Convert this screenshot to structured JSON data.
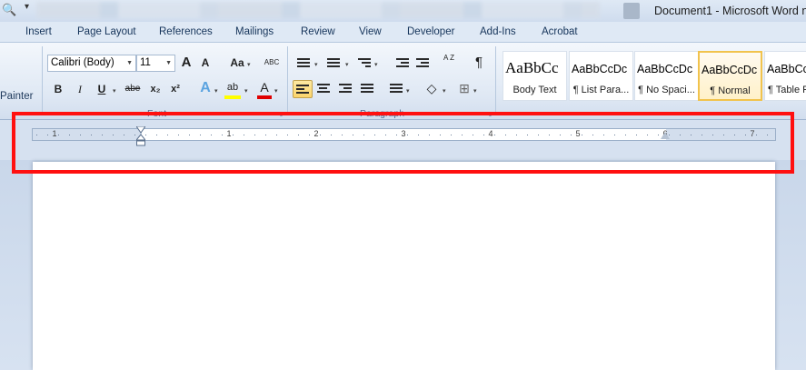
{
  "window": {
    "title": "Document1  -  Microsoft Word n"
  },
  "tabs": [
    "Insert",
    "Page Layout",
    "References",
    "Mailings",
    "Review",
    "View",
    "Developer",
    "Add-Ins",
    "Acrobat"
  ],
  "clipboard": {
    "painter_label": "Painter"
  },
  "font_group": {
    "label": "Font",
    "font_name": "Calibri (Body)",
    "font_size": "11",
    "grow_font": "A",
    "shrink_font": "A",
    "change_case": "Aa",
    "clear_format": "ABC",
    "bold": "B",
    "italic": "I",
    "underline": "U",
    "strikethrough": "abe",
    "subscript": "x₂",
    "superscript": "x²",
    "text_effects": "A",
    "highlight": "ab",
    "font_color": "A"
  },
  "paragraph_group": {
    "label": "Paragraph",
    "sort": "A Z",
    "show_marks": "¶"
  },
  "styles": [
    {
      "sample": "AaBbCc",
      "name": "Body Text"
    },
    {
      "sample": "AaBbCcDc",
      "name": "¶ List Para..."
    },
    {
      "sample": "AaBbCcDc",
      "name": "¶ No Spaci..."
    },
    {
      "sample": "AaBbCcDc",
      "name": "¶ Normal"
    },
    {
      "sample": "AaBbCc",
      "name": "¶ Table P"
    }
  ],
  "ruler": {
    "numbers": [
      "1",
      "1",
      "2",
      "3",
      "4",
      "5",
      "6",
      "7"
    ]
  },
  "colors": {
    "font_color_bar": "#e00000",
    "highlight_bar": "#ffff00",
    "selection": "#fbd46c",
    "annotation": "#ff1010"
  }
}
